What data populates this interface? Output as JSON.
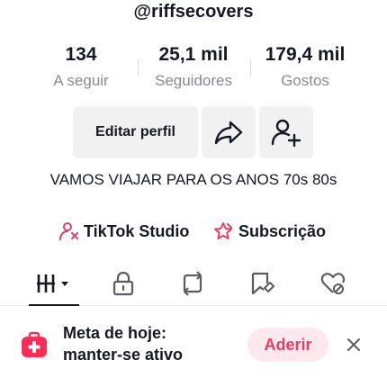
{
  "profile": {
    "username": "@riffsecovers",
    "bio": "VAMOS VIAJAR PARA OS ANOS 70s 80s"
  },
  "stats": {
    "following": {
      "value": "134",
      "label": "A seguir"
    },
    "followers": {
      "value": "25,1 mil",
      "label": "Seguidores"
    },
    "likes": {
      "value": "179,4 mil",
      "label": "Gostos"
    }
  },
  "actions": {
    "edit_label": "Editar perfil",
    "share_icon": "share-arrow-icon",
    "add_friend_icon": "add-user-icon"
  },
  "links": {
    "studio_label": "TikTok Studio",
    "subscription_label": "Subscrição",
    "accent": "#e83e63"
  },
  "tabs": [
    {
      "icon": "videos-grid-icon",
      "active": true
    },
    {
      "icon": "lock-icon",
      "active": false
    },
    {
      "icon": "repost-icon",
      "active": false
    },
    {
      "icon": "favorites-icon",
      "active": false
    },
    {
      "icon": "liked-icon",
      "active": false
    }
  ],
  "banner": {
    "title": "Meta de hoje:",
    "subtitle": "manter-se ativo",
    "join_label": "Aderir",
    "icon": "medkit-icon"
  }
}
